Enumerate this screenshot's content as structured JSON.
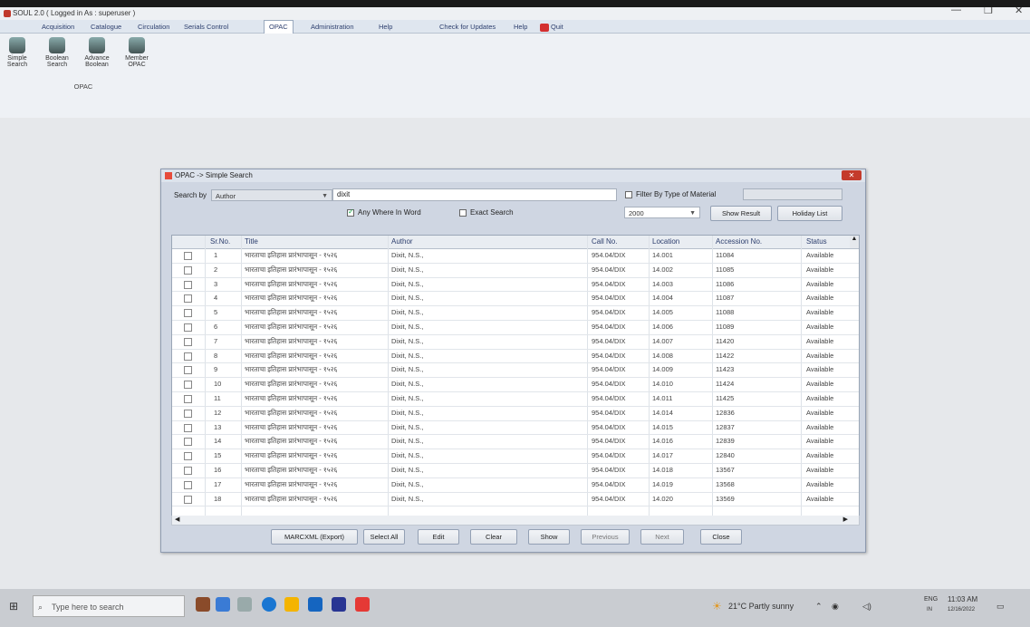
{
  "window": {
    "title": "SOUL 2.0 ( Logged in As : superuser )",
    "minimize": "—",
    "restore": "❐",
    "close": "✕"
  },
  "menu": {
    "items": [
      "Acquisition",
      "Catalogue",
      "Circulation",
      "Serials Control",
      "OPAC",
      "Administration",
      "Help"
    ],
    "check_updates": "Check for Updates",
    "help": "Help",
    "quit": "Quit"
  },
  "ribbon": {
    "buttons": [
      {
        "label1": "Simple",
        "label2": "Search",
        "icon": "magnifier-icon"
      },
      {
        "label1": "Boolean",
        "label2": "Search",
        "icon": "boolean-search-icon"
      },
      {
        "label1": "Advance",
        "label2": "Boolean",
        "icon": "advance-boolean-icon"
      },
      {
        "label1": "Member",
        "label2": "OPAC",
        "icon": "member-opac-icon"
      }
    ],
    "group_label": "OPAC"
  },
  "dialog": {
    "title": "OPAC -> Simple Search",
    "close": "✕",
    "search_by_label": "Search by",
    "search_by_value": "Author",
    "search_text": "dixit",
    "filter_label": "Filter By Type of Material",
    "any_where_label": "Any Where In Word",
    "exact_label": "Exact Search",
    "year": "2000",
    "show_result": "Show Result",
    "holiday_list": "Holiday List",
    "columns": [
      "Sr.No.",
      "Title",
      "Author",
      "Call No.",
      "Location",
      "Accession No.",
      "Status"
    ],
    "rows": [
      {
        "sr": "1",
        "title": "भारताचा इतिहास प्रारंभापासून - १५२६",
        "author": "Dixit, N.S.,",
        "call": "954.04/DIX",
        "loc": "14.001",
        "acc": "11084",
        "status": "Available"
      },
      {
        "sr": "2",
        "title": "भारताचा इतिहास प्रारंभापासून - १५२६",
        "author": "Dixit, N.S.,",
        "call": "954.04/DIX",
        "loc": "14.002",
        "acc": "11085",
        "status": "Available"
      },
      {
        "sr": "3",
        "title": "भारताचा इतिहास प्रारंभापासून - १५२६",
        "author": "Dixit, N.S.,",
        "call": "954.04/DIX",
        "loc": "14.003",
        "acc": "11086",
        "status": "Available"
      },
      {
        "sr": "4",
        "title": "भारताचा इतिहास प्रारंभापासून - १५२६",
        "author": "Dixit, N.S.,",
        "call": "954.04/DIX",
        "loc": "14.004",
        "acc": "11087",
        "status": "Available"
      },
      {
        "sr": "5",
        "title": "भारताचा इतिहास प्रारंभापासून - १५२६",
        "author": "Dixit, N.S.,",
        "call": "954.04/DIX",
        "loc": "14.005",
        "acc": "11088",
        "status": "Available"
      },
      {
        "sr": "6",
        "title": "भारताचा इतिहास प्रारंभापासून - १५२६",
        "author": "Dixit, N.S.,",
        "call": "954.04/DIX",
        "loc": "14.006",
        "acc": "11089",
        "status": "Available"
      },
      {
        "sr": "7",
        "title": "भारताचा इतिहास प्रारंभापासून - १५२६",
        "author": "Dixit, N.S.,",
        "call": "954.04/DIX",
        "loc": "14.007",
        "acc": "11420",
        "status": "Available"
      },
      {
        "sr": "8",
        "title": "भारताचा इतिहास प्रारंभापासून - १५२६",
        "author": "Dixit, N.S.,",
        "call": "954.04/DIX",
        "loc": "14.008",
        "acc": "11422",
        "status": "Available"
      },
      {
        "sr": "9",
        "title": "भारताचा इतिहास प्रारंभापासून - १५२६",
        "author": "Dixit, N.S.,",
        "call": "954.04/DIX",
        "loc": "14.009",
        "acc": "11423",
        "status": "Available"
      },
      {
        "sr": "10",
        "title": "भारताचा इतिहास प्रारंभापासून - १५२६",
        "author": "Dixit, N.S.,",
        "call": "954.04/DIX",
        "loc": "14.010",
        "acc": "11424",
        "status": "Available"
      },
      {
        "sr": "11",
        "title": "भारताचा इतिहास प्रारंभापासून - १५२६",
        "author": "Dixit, N.S.,",
        "call": "954.04/DIX",
        "loc": "14.011",
        "acc": "11425",
        "status": "Available"
      },
      {
        "sr": "12",
        "title": "भारताचा इतिहास प्रारंभापासून - १५२६",
        "author": "Dixit, N.S.,",
        "call": "954.04/DIX",
        "loc": "14.014",
        "acc": "12836",
        "status": "Available"
      },
      {
        "sr": "13",
        "title": "भारताचा इतिहास प्रारंभापासून - १५२६",
        "author": "Dixit, N.S.,",
        "call": "954.04/DIX",
        "loc": "14.015",
        "acc": "12837",
        "status": "Available"
      },
      {
        "sr": "14",
        "title": "भारताचा इतिहास प्रारंभापासून - १५२६",
        "author": "Dixit, N.S.,",
        "call": "954.04/DIX",
        "loc": "14.016",
        "acc": "12839",
        "status": "Available"
      },
      {
        "sr": "15",
        "title": "भारताचा इतिहास प्रारंभापासून - १५२६",
        "author": "Dixit, N.S.,",
        "call": "954.04/DIX",
        "loc": "14.017",
        "acc": "12840",
        "status": "Available"
      },
      {
        "sr": "16",
        "title": "भारताचा इतिहास प्रारंभापासून - १५२६",
        "author": "Dixit, N.S.,",
        "call": "954.04/DIX",
        "loc": "14.018",
        "acc": "13567",
        "status": "Available"
      },
      {
        "sr": "17",
        "title": "भारताचा इतिहास प्रारंभापासून - १५२६",
        "author": "Dixit, N.S.,",
        "call": "954.04/DIX",
        "loc": "14.019",
        "acc": "13568",
        "status": "Available"
      },
      {
        "sr": "18",
        "title": "भारताचा इतिहास प्रारंभापासून - १५२६",
        "author": "Dixit, N.S.,",
        "call": "954.04/DIX",
        "loc": "14.020",
        "acc": "13569",
        "status": "Available"
      }
    ],
    "buttons": {
      "export": "MARCXML (Export)",
      "select_all": "Select All",
      "edit": "Edit",
      "clear": "Clear",
      "show": "Show",
      "previous": "Previous",
      "next": "Next",
      "close": "Close"
    }
  },
  "taskbar": {
    "search_placeholder": "Type here to search",
    "weather": "21°C  Partly sunny",
    "lang": "ENG",
    "region": "IN",
    "time": "11:03 AM",
    "date": "12/16/2022"
  },
  "colors": {
    "accent": "#2c3e6d",
    "close_red": "#c43b2b",
    "dialog_bg": "#cfd6e2"
  }
}
